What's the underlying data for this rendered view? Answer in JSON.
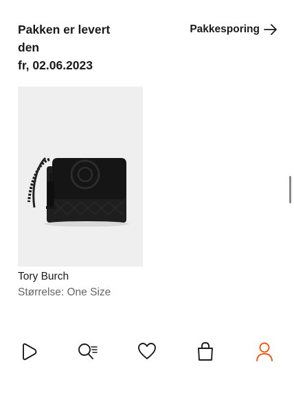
{
  "delivery": {
    "title_line1": "Pakken er levert",
    "title_line2": "den",
    "title_line3": "fr, 02.06.2023"
  },
  "tracking": {
    "label": "Pakkesporing",
    "icon": "arrow-right-icon"
  },
  "product": {
    "brand": "Tory Burch",
    "size_label": "Størrelse:",
    "size_value": "One Size",
    "image_icon": "black-shoulder-bag-image"
  },
  "tabbar": {
    "items": [
      {
        "icon": "play-icon"
      },
      {
        "icon": "search-list-icon"
      },
      {
        "icon": "heart-icon"
      },
      {
        "icon": "shopping-bag-icon"
      },
      {
        "icon": "profile-icon",
        "active": true
      }
    ],
    "active_color": "#e8591a",
    "inactive_color": "#1a1a1a"
  }
}
